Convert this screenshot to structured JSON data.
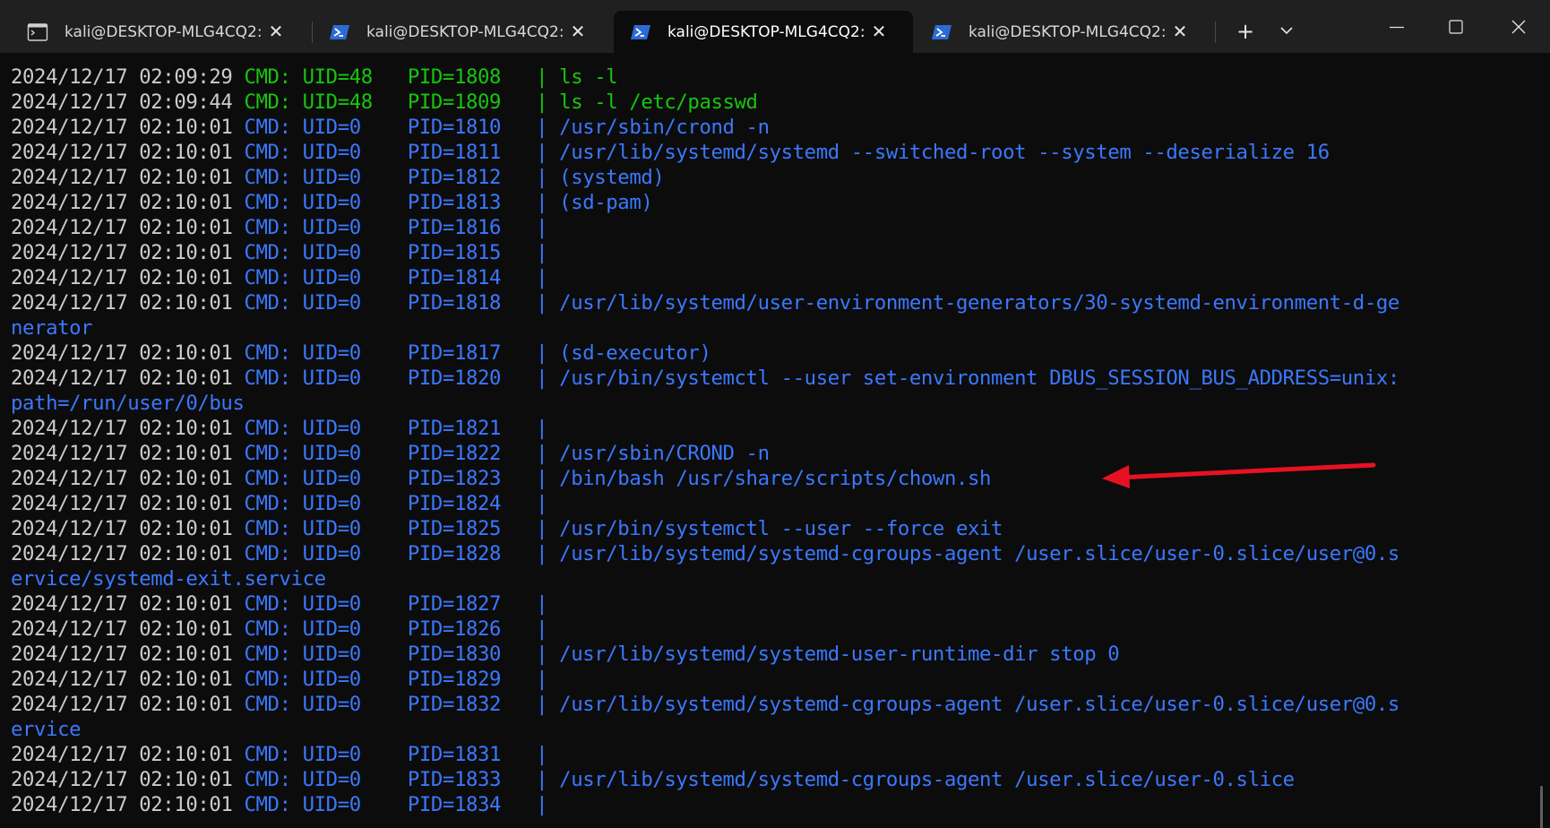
{
  "tabs": [
    {
      "title": "kali@DESKTOP-MLG4CQ2: ~",
      "icon": "console-icon",
      "active": false
    },
    {
      "title": "kali@DESKTOP-MLG4CQ2: ~",
      "icon": "powershell-icon",
      "active": false
    },
    {
      "title": "kali@DESKTOP-MLG4CQ2: ~",
      "icon": "powershell-icon",
      "active": true
    },
    {
      "title": "kali@DESKTOP-MLG4CQ2: ~",
      "icon": "powershell-icon",
      "active": false
    }
  ],
  "new_tab_label": "+",
  "colors": {
    "background": "#0c0c0c",
    "titlebar": "#202020",
    "text": "#cccccc",
    "green": "#16c60c",
    "blue": "#3b78ff",
    "arrow": "#e81123"
  },
  "log_lines": [
    {
      "ts": "2024/12/17 02:09:29",
      "uid": "CMD: UID=48   ",
      "pid": "PID=1808   ",
      "sep": "| ",
      "cmd": "ls -l",
      "color": "green"
    },
    {
      "ts": "2024/12/17 02:09:44",
      "uid": "CMD: UID=48   ",
      "pid": "PID=1809   ",
      "sep": "| ",
      "cmd": "ls -l /etc/passwd",
      "color": "green"
    },
    {
      "ts": "2024/12/17 02:10:01",
      "uid": "CMD: UID=0    ",
      "pid": "PID=1810   ",
      "sep": "| ",
      "cmd": "/usr/sbin/crond -n",
      "color": "blue"
    },
    {
      "ts": "2024/12/17 02:10:01",
      "uid": "CMD: UID=0    ",
      "pid": "PID=1811   ",
      "sep": "| ",
      "cmd": "/usr/lib/systemd/systemd --switched-root --system --deserialize 16",
      "color": "blue"
    },
    {
      "ts": "2024/12/17 02:10:01",
      "uid": "CMD: UID=0    ",
      "pid": "PID=1812   ",
      "sep": "| ",
      "cmd": "(systemd)",
      "color": "blue"
    },
    {
      "ts": "2024/12/17 02:10:01",
      "uid": "CMD: UID=0    ",
      "pid": "PID=1813   ",
      "sep": "| ",
      "cmd": "(sd-pam)",
      "color": "blue"
    },
    {
      "ts": "2024/12/17 02:10:01",
      "uid": "CMD: UID=0    ",
      "pid": "PID=1816   ",
      "sep": "| ",
      "cmd": "",
      "color": "blue"
    },
    {
      "ts": "2024/12/17 02:10:01",
      "uid": "CMD: UID=0    ",
      "pid": "PID=1815   ",
      "sep": "| ",
      "cmd": "",
      "color": "blue"
    },
    {
      "ts": "2024/12/17 02:10:01",
      "uid": "CMD: UID=0    ",
      "pid": "PID=1814   ",
      "sep": "| ",
      "cmd": "",
      "color": "blue"
    },
    {
      "ts": "2024/12/17 02:10:01",
      "uid": "CMD: UID=0    ",
      "pid": "PID=1818   ",
      "sep": "| ",
      "cmd": "/usr/lib/systemd/user-environment-generators/30-systemd-environment-d-ge",
      "color": "blue"
    },
    {
      "wrap": "nerator"
    },
    {
      "ts": "2024/12/17 02:10:01",
      "uid": "CMD: UID=0    ",
      "pid": "PID=1817   ",
      "sep": "| ",
      "cmd": "(sd-executor)",
      "color": "blue"
    },
    {
      "ts": "2024/12/17 02:10:01",
      "uid": "CMD: UID=0    ",
      "pid": "PID=1820   ",
      "sep": "| ",
      "cmd": "/usr/bin/systemctl --user set-environment DBUS_SESSION_BUS_ADDRESS=unix:",
      "color": "blue"
    },
    {
      "wrap": "path=/run/user/0/bus"
    },
    {
      "ts": "2024/12/17 02:10:01",
      "uid": "CMD: UID=0    ",
      "pid": "PID=1821   ",
      "sep": "| ",
      "cmd": "",
      "color": "blue"
    },
    {
      "ts": "2024/12/17 02:10:01",
      "uid": "CMD: UID=0    ",
      "pid": "PID=1822   ",
      "sep": "| ",
      "cmd": "/usr/sbin/CROND -n",
      "color": "blue"
    },
    {
      "ts": "2024/12/17 02:10:01",
      "uid": "CMD: UID=0    ",
      "pid": "PID=1823   ",
      "sep": "| ",
      "cmd": "/bin/bash /usr/share/scripts/chown.sh",
      "color": "blue"
    },
    {
      "ts": "2024/12/17 02:10:01",
      "uid": "CMD: UID=0    ",
      "pid": "PID=1824   ",
      "sep": "| ",
      "cmd": "",
      "color": "blue"
    },
    {
      "ts": "2024/12/17 02:10:01",
      "uid": "CMD: UID=0    ",
      "pid": "PID=1825   ",
      "sep": "| ",
      "cmd": "/usr/bin/systemctl --user --force exit",
      "color": "blue"
    },
    {
      "ts": "2024/12/17 02:10:01",
      "uid": "CMD: UID=0    ",
      "pid": "PID=1828   ",
      "sep": "| ",
      "cmd": "/usr/lib/systemd/systemd-cgroups-agent /user.slice/user-0.slice/user@0.s",
      "color": "blue"
    },
    {
      "wrap": "ervice/systemd-exit.service"
    },
    {
      "ts": "2024/12/17 02:10:01",
      "uid": "CMD: UID=0    ",
      "pid": "PID=1827   ",
      "sep": "| ",
      "cmd": "",
      "color": "blue"
    },
    {
      "ts": "2024/12/17 02:10:01",
      "uid": "CMD: UID=0    ",
      "pid": "PID=1826   ",
      "sep": "| ",
      "cmd": "",
      "color": "blue"
    },
    {
      "ts": "2024/12/17 02:10:01",
      "uid": "CMD: UID=0    ",
      "pid": "PID=1830   ",
      "sep": "| ",
      "cmd": "/usr/lib/systemd/systemd-user-runtime-dir stop 0",
      "color": "blue"
    },
    {
      "ts": "2024/12/17 02:10:01",
      "uid": "CMD: UID=0    ",
      "pid": "PID=1829   ",
      "sep": "| ",
      "cmd": "",
      "color": "blue"
    },
    {
      "ts": "2024/12/17 02:10:01",
      "uid": "CMD: UID=0    ",
      "pid": "PID=1832   ",
      "sep": "| ",
      "cmd": "/usr/lib/systemd/systemd-cgroups-agent /user.slice/user-0.slice/user@0.s",
      "color": "blue"
    },
    {
      "wrap": "ervice"
    },
    {
      "ts": "2024/12/17 02:10:01",
      "uid": "CMD: UID=0    ",
      "pid": "PID=1831   ",
      "sep": "| ",
      "cmd": "",
      "color": "blue"
    },
    {
      "ts": "2024/12/17 02:10:01",
      "uid": "CMD: UID=0    ",
      "pid": "PID=1833   ",
      "sep": "| ",
      "cmd": "/usr/lib/systemd/systemd-cgroups-agent /user.slice/user-0.slice",
      "color": "blue"
    },
    {
      "ts": "2024/12/17 02:10:01",
      "uid": "CMD: UID=0    ",
      "pid": "PID=1834   ",
      "sep": "| ",
      "cmd": "",
      "color": "blue"
    }
  ]
}
